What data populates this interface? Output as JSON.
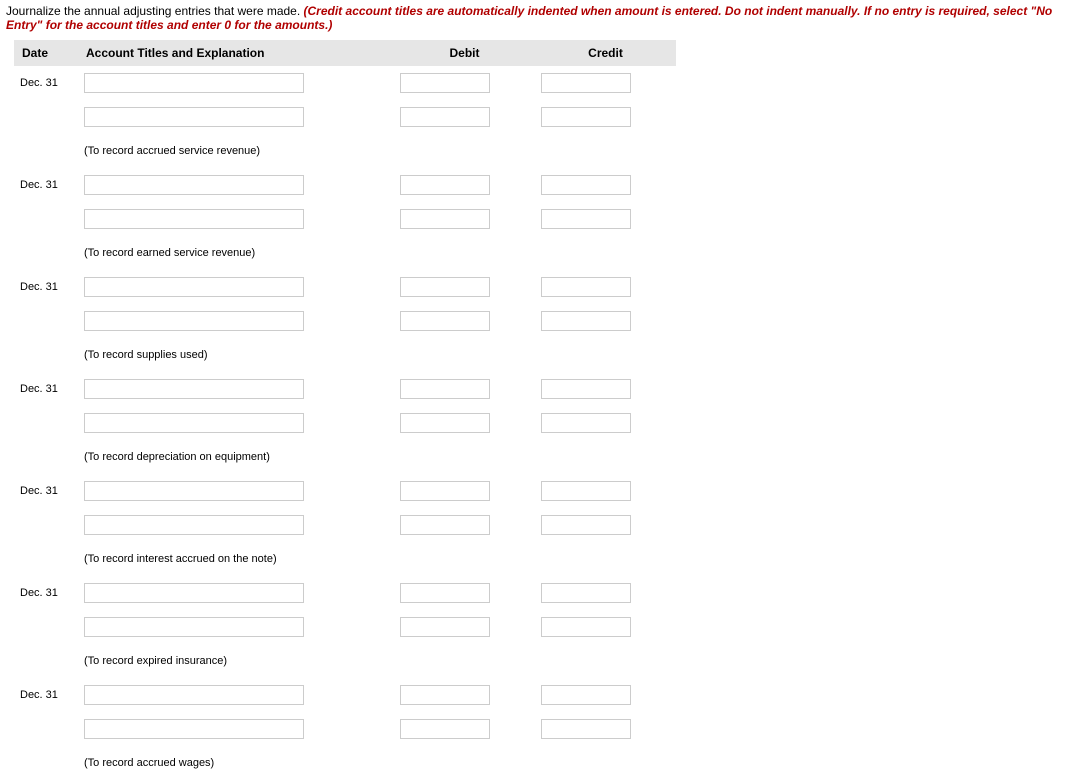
{
  "instructions": {
    "lead": "Journalize the annual adjusting entries that were made. ",
    "note": "(Credit account titles are automatically indented when amount is entered. Do not indent manually. If no entry is required, select \"No Entry\" for the account titles and enter 0 for the amounts.)"
  },
  "headers": {
    "date": "Date",
    "account": "Account Titles and Explanation",
    "debit": "Debit",
    "credit": "Credit"
  },
  "entries": [
    {
      "date": "Dec. 31",
      "explanation": "(To record accrued service revenue)"
    },
    {
      "date": "Dec. 31",
      "explanation": "(To record earned service revenue)"
    },
    {
      "date": "Dec. 31",
      "explanation": "(To record supplies used)"
    },
    {
      "date": "Dec. 31",
      "explanation": "(To record depreciation on equipment)"
    },
    {
      "date": "Dec. 31",
      "explanation": "(To record interest accrued on the note)"
    },
    {
      "date": "Dec. 31",
      "explanation": "(To record expired insurance)"
    },
    {
      "date": "Dec. 31",
      "explanation": "(To record accrued wages)"
    }
  ]
}
